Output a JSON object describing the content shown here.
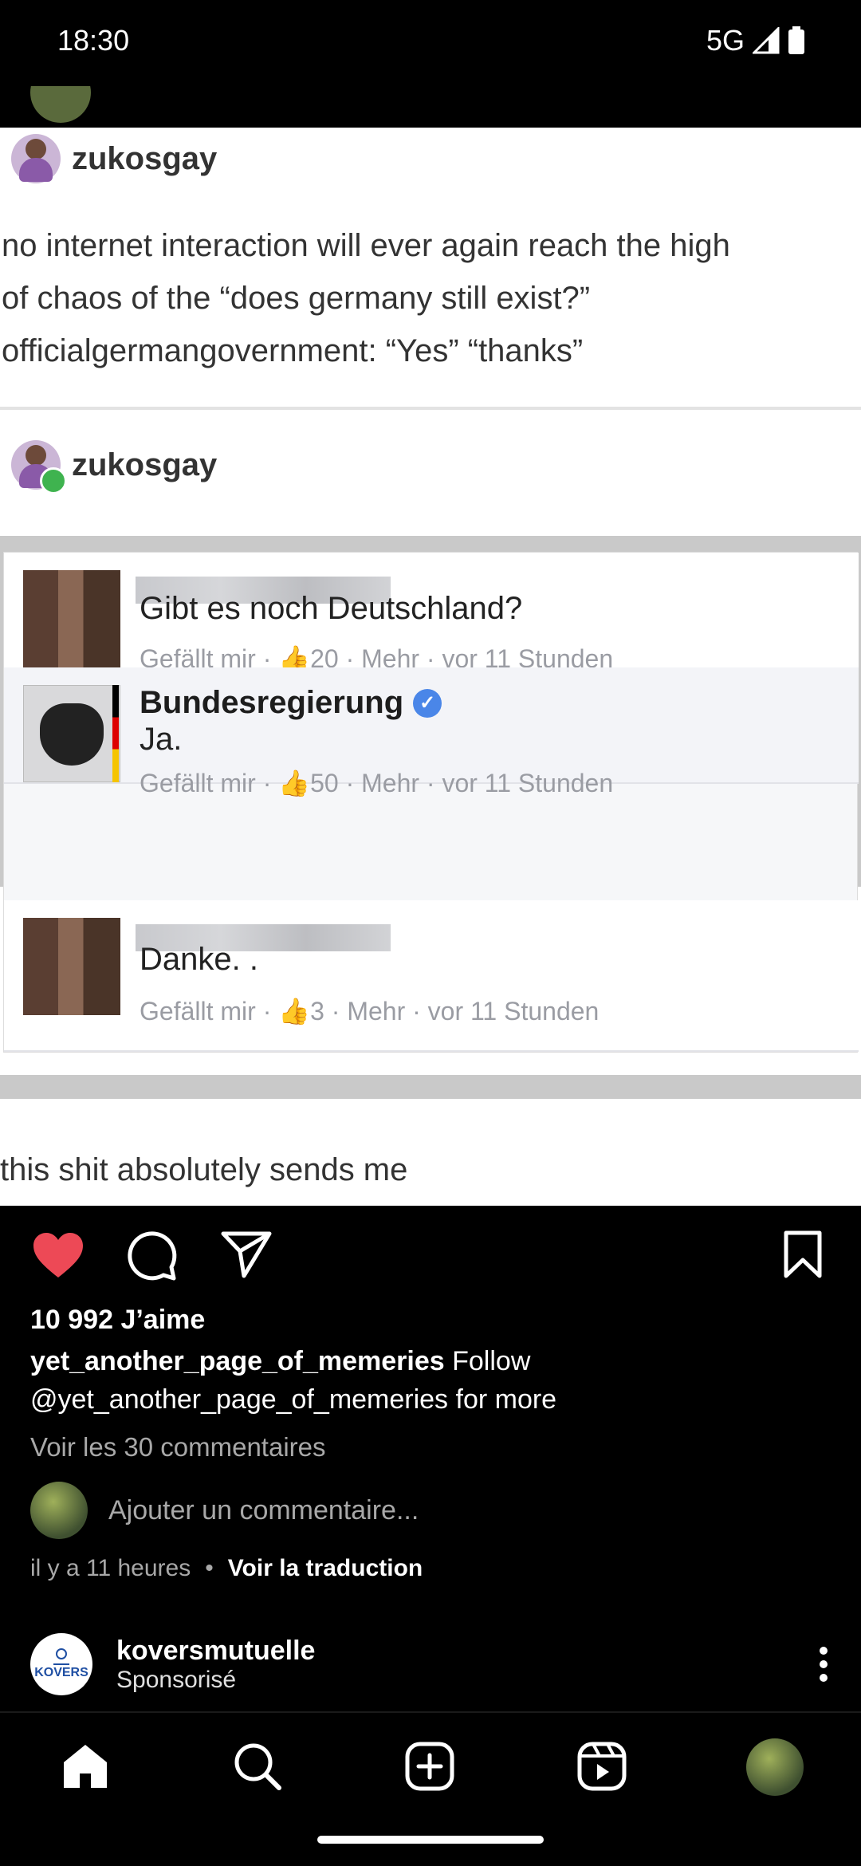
{
  "status_bar": {
    "time": "18:30",
    "network": "5G"
  },
  "post": {
    "image": {
      "tumblr_user_1": "zukosgay",
      "tumblr_text": "no internet interaction will ever again reach the high\nof chaos of the “does germany still exist?”\nofficialgermangovernment: “Yes” “thanks”",
      "tumblr_user_2": "zukosgay",
      "comments": [
        {
          "name": "",
          "text": "Gibt es noch Deutschland?",
          "meta": "Gefällt mir · 👍20 · Mehr · vor 11 Stunden"
        },
        {
          "name": "Bundesregierung",
          "text": "Ja.",
          "meta": "Gefällt mir · 👍50 · Mehr · vor 11 Stunden"
        },
        {
          "name": "",
          "text": "Danke. .",
          "meta": "Gefällt mir · 👍3 · Mehr · vor 11 Stunden"
        }
      ],
      "caption": "this shit absolutely sends me"
    },
    "likes": "10 992 J’aime",
    "caption_user": "yet_another_page_of_memeries",
    "caption_text": " Follow",
    "caption_text_2": "@yet_another_page_of_memeries for more",
    "view_comments": "Voir les 30 commentaires",
    "comment_placeholder": "Ajouter un commentaire...",
    "time_ago": "il y a 11 heures",
    "translate": "Voir la traduction"
  },
  "sponsored": {
    "name": "koversmutuelle",
    "label": "Sponsorisé",
    "logo_text": "KOVERS"
  },
  "colors": {
    "like_red": "#ed4956",
    "background": "#000000"
  }
}
